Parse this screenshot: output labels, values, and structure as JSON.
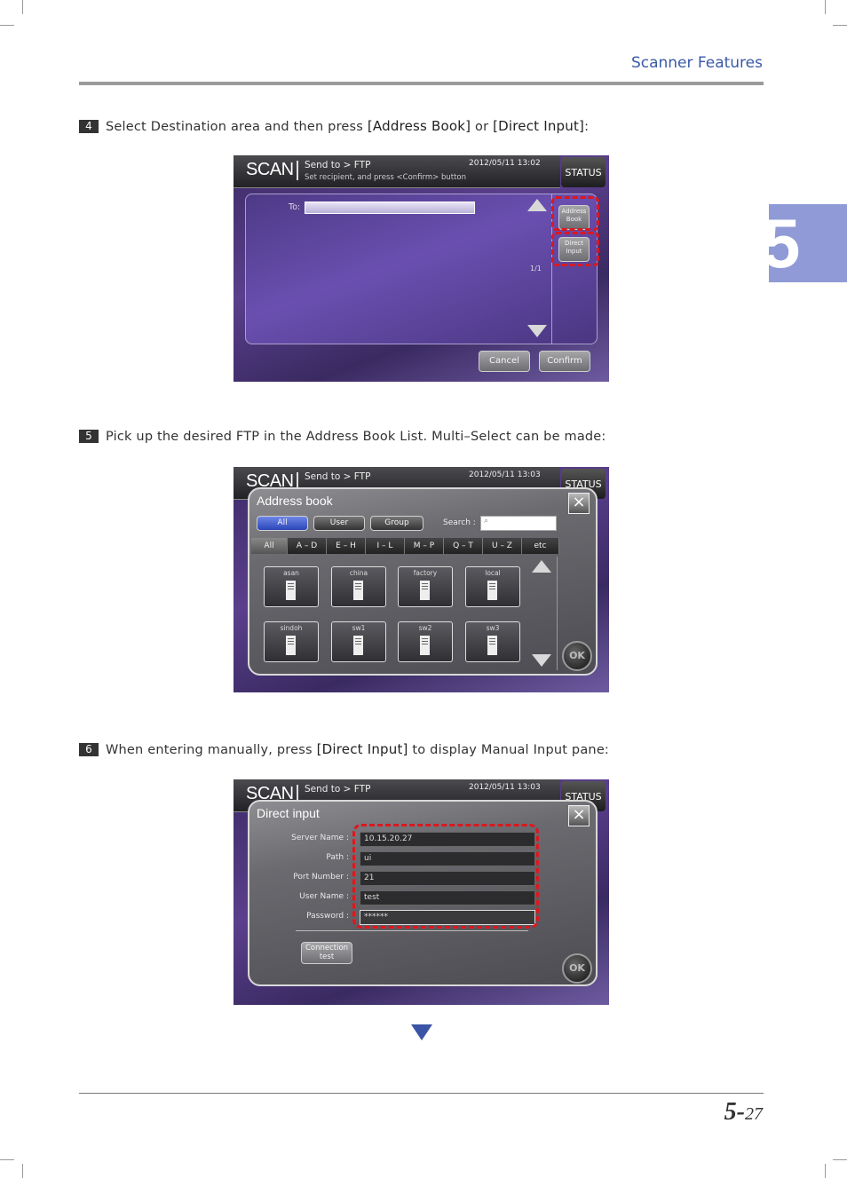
{
  "header": {
    "section": "Scanner Features"
  },
  "chapter_tab": "5",
  "steps": [
    {
      "num": "4",
      "pre": "Select Destination area and then press ",
      "kw1": "[Address Book]",
      "mid": " or ",
      "kw2": "[Direct Input]",
      "post": ":"
    },
    {
      "num": "5",
      "text": "Pick up the desired FTP in the Address Book List. Multi–Select can be made:"
    },
    {
      "num": "6",
      "pre": "When entering manually, press ",
      "kw1": "[Direct Input]",
      "post": " to display Manual Input pane:"
    }
  ],
  "screen_common": {
    "title": "SCAN",
    "send_to": "Send to > FTP",
    "status": "STATUS"
  },
  "screen1": {
    "subline": "Set recipient, and press <Confirm> button",
    "timestamp": "2012/05/11 13:02",
    "to_label": "To:",
    "page_indicator": "1/1",
    "address_book_l1": "Address",
    "address_book_l2": "Book",
    "direct_input_l1": "Direct",
    "direct_input_l2": "Input",
    "cancel": "Cancel",
    "confirm": "Confirm"
  },
  "screen2": {
    "timestamp": "2012/05/11 13:03",
    "dialog_title": "Address book",
    "filters": [
      "All",
      "User",
      "Group"
    ],
    "search_label": "Search :",
    "index_tabs": [
      "All",
      "A – D",
      "E – H",
      "I – L",
      "M – P",
      "Q – T",
      "U – Z",
      "etc"
    ],
    "entries": [
      "asan",
      "china",
      "factory",
      "local",
      "sindoh",
      "sw1",
      "sw2",
      "sw3"
    ],
    "ok": "OK"
  },
  "screen3": {
    "timestamp": "2012/05/11 13:03",
    "dialog_title": "Direct input",
    "fields": [
      {
        "label": "Server Name :",
        "value": "10.15.20.27"
      },
      {
        "label": "Path :",
        "value": "ui"
      },
      {
        "label": "Port Number :",
        "value": "21"
      },
      {
        "label": "User Name :",
        "value": "test"
      },
      {
        "label": "Password :",
        "value": "******"
      }
    ],
    "conn_l1": "Connection",
    "conn_l2": "test",
    "ok": "OK"
  },
  "footer": {
    "page_major": "5-",
    "page_minor": "27"
  },
  "colors": {
    "accent": "#3a5aa8",
    "tab": "#8f9ad6",
    "highlight": "#e0161d"
  }
}
